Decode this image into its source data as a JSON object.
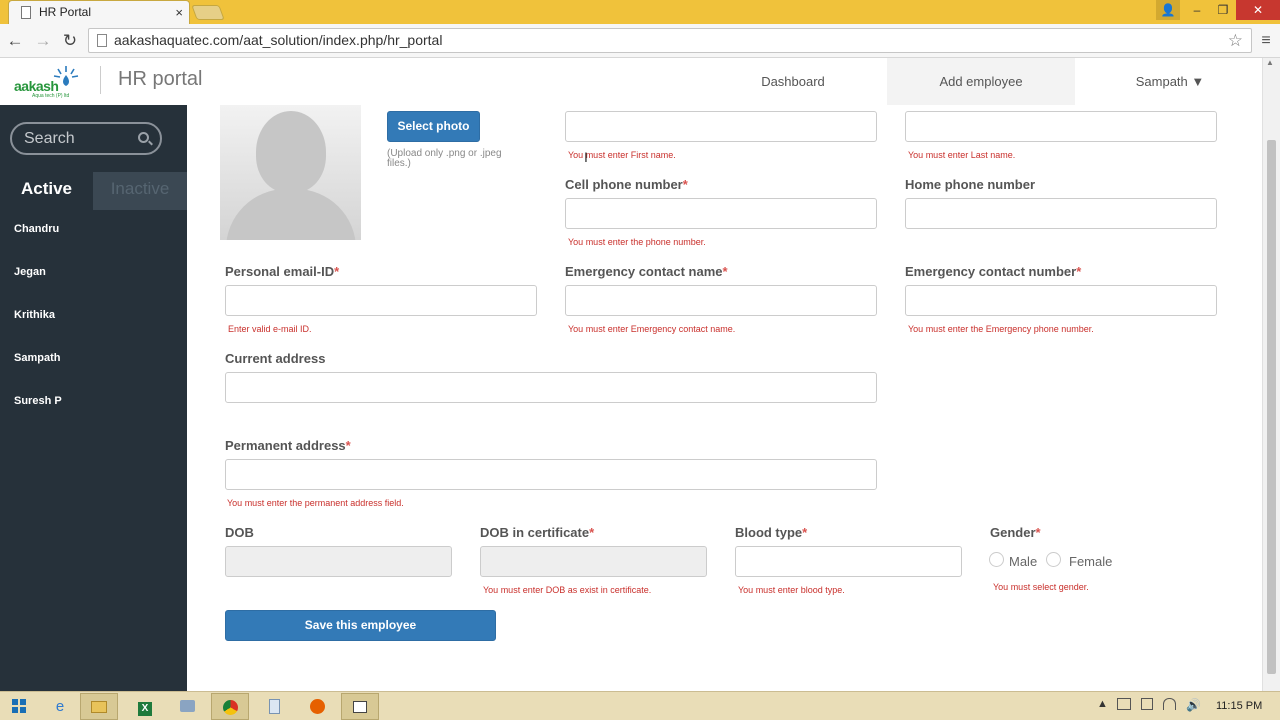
{
  "browser": {
    "tab_title": "HR Portal",
    "tab_close": "×",
    "url": "aakashaquatec.com/aat_solution/index.php/hr_portal",
    "window_user": "👤",
    "window_min": "–",
    "window_max": "❐",
    "window_close": "✕",
    "back": "←",
    "forward": "→",
    "reload": "↻",
    "star": "☆",
    "menu": "≡"
  },
  "header": {
    "logo_text": "aakash",
    "logo_subtext": "Aqua tech (P) ltd",
    "brand": "HR portal",
    "nav": {
      "dashboard": "Dashboard",
      "add_employee": "Add employee",
      "user": "Sampath ▼"
    }
  },
  "sidebar": {
    "search_placeholder": "Search",
    "tab_active": "Active",
    "tab_inactive": "Inactive",
    "employees": [
      "Chandru",
      "Jegan",
      "Krithika",
      "Sampath",
      "Suresh P"
    ]
  },
  "form": {
    "select_photo": "Select photo",
    "upload_hint": "(Upload only .png or .jpeg files.)",
    "errors": {
      "first_name": "You must enter First name.",
      "last_name": "You must enter Last name.",
      "cell_phone": "You must enter the phone number.",
      "email": "Enter valid e-mail ID.",
      "emergency_name": "You must enter Emergency contact name.",
      "emergency_number": "You must enter the Emergency phone number.",
      "permanent_address": "You must enter the permanent address field.",
      "dob_certificate": "You must enter DOB as exist in certificate.",
      "blood_type": "You must enter blood type.",
      "gender": "You must select gender."
    },
    "labels": {
      "cell_phone": "Cell phone number",
      "home_phone": "Home phone number",
      "email": "Personal email-ID",
      "emergency_name": "Emergency contact name",
      "emergency_number": "Emergency contact number",
      "current_address": "Current address",
      "permanent_address": "Permanent address",
      "dob": "DOB",
      "dob_certificate": "DOB in certificate",
      "blood_type": "Blood type",
      "gender": "Gender"
    },
    "required_mark": "*",
    "gender_options": [
      "Male",
      "Female"
    ],
    "save_button": "Save this employee"
  },
  "taskbar": {
    "clock": "11:15 PM",
    "tray_arrow": "▲"
  },
  "colors": {
    "sidebar_bg": "#26313a",
    "primary_button": "#337ab7",
    "error": "#c9302c",
    "titlebar": "#f0c23b"
  }
}
